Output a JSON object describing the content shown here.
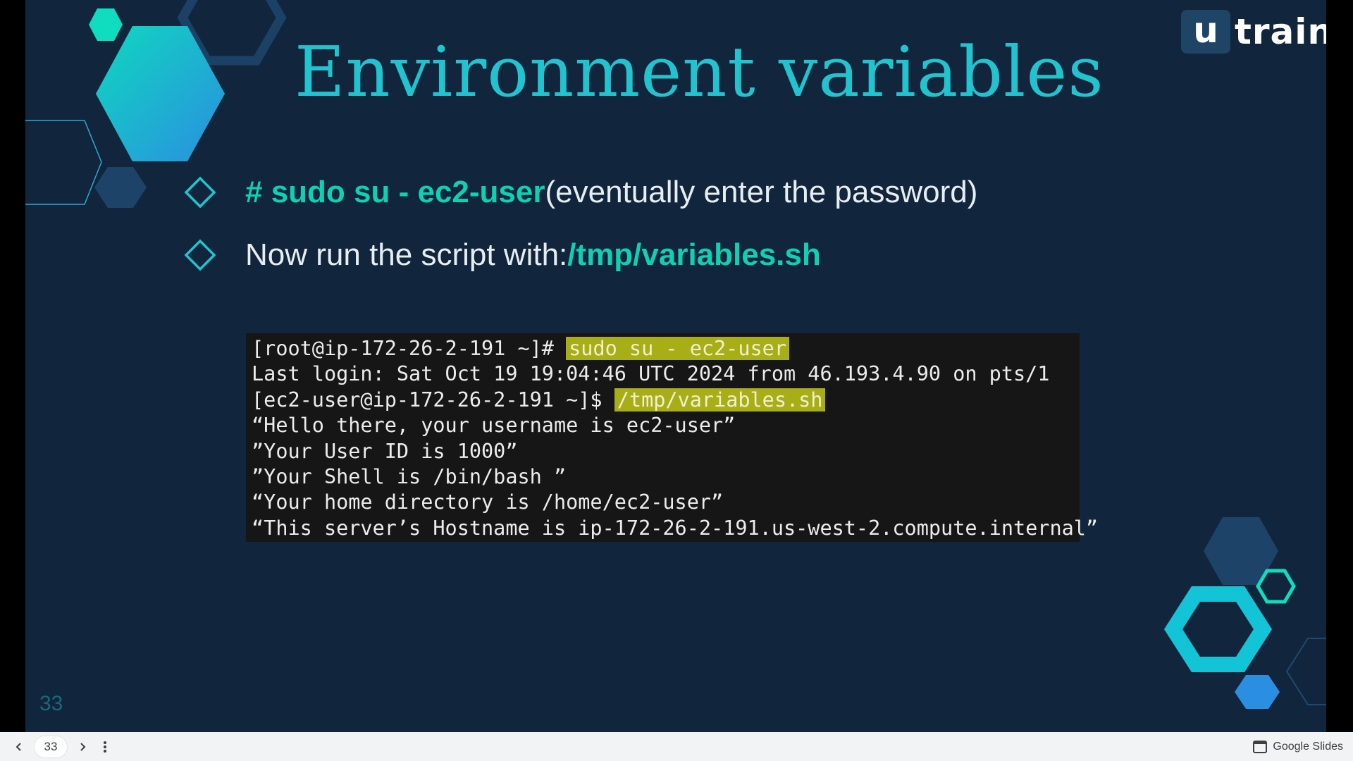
{
  "slide": {
    "title": "Environment variables",
    "number": "33",
    "logo": {
      "mark": "u",
      "text": "train"
    },
    "bullets": [
      {
        "accent": "# sudo su - ec2-user",
        "rest": " (eventually enter the password)"
      },
      {
        "rest": "Now run the script with: ",
        "accent": "/tmp/variables.sh"
      }
    ],
    "terminal": {
      "line1_prompt": "[root@ip-172-26-2-191 ~]# ",
      "line1_cmd": "sudo su - ec2-user",
      "line2": "Last login: Sat Oct 19 19:04:46 UTC 2024 from 46.193.4.90 on pts/1",
      "line3_prompt": "[ec2-user@ip-172-26-2-191 ~]$ ",
      "line3_cmd": "/tmp/variables.sh",
      "line4": "“Hello there, your username is ec2-user”",
      "line5": "”Your User ID is 1000”",
      "line6": "”Your Shell is /bin/bash ”",
      "line7": "“Your home directory is /home/ec2-user”",
      "line8": "“This server’s Hostname is ip-172-26-2-191.us-west-2.compute.internal”"
    }
  },
  "bottombar": {
    "page": "33",
    "app_name": "Google Slides",
    "prev_icon": "chevron-left-icon",
    "next_icon": "chevron-right-icon",
    "menu_icon": "more-vert-icon"
  },
  "colors": {
    "background": "#11263c",
    "title": "#21c3cf",
    "accent": "#10d0b4",
    "highlight": "#a8ae16"
  }
}
